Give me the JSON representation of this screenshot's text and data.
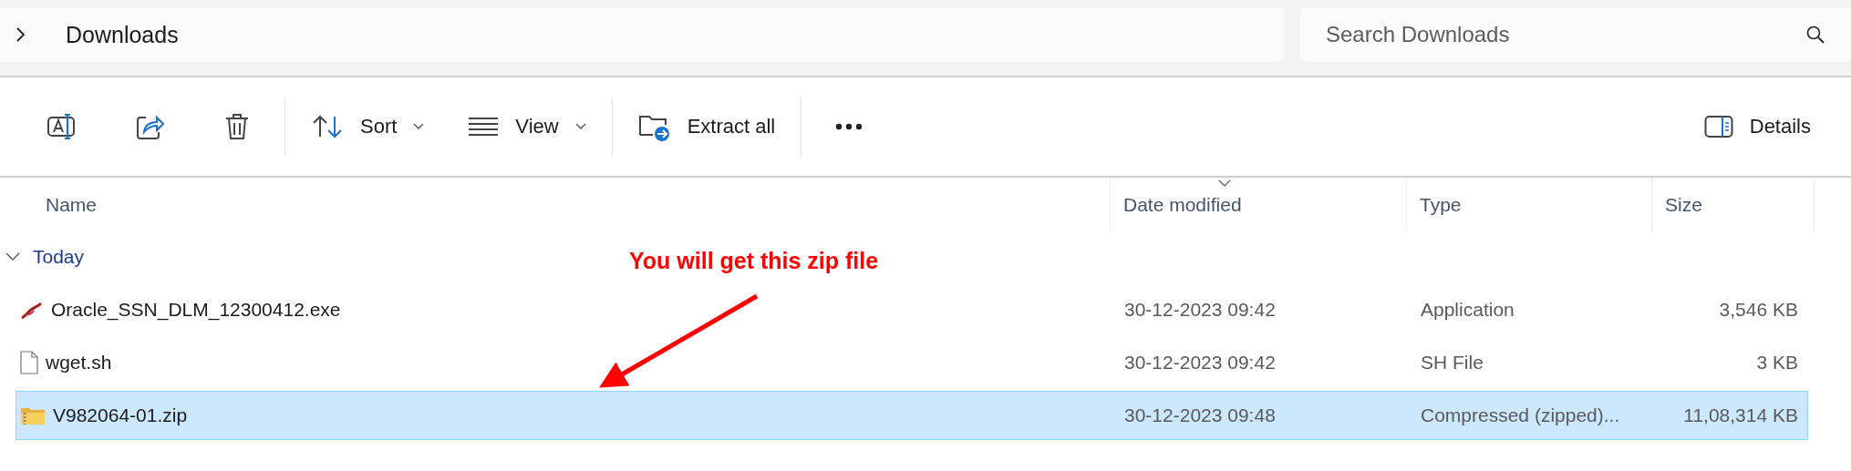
{
  "address": {
    "path": "Downloads"
  },
  "search": {
    "placeholder": "Search Downloads"
  },
  "toolbar": {
    "sort": "Sort",
    "view": "View",
    "extract": "Extract all",
    "details": "Details"
  },
  "columns": [
    {
      "label": "Name",
      "sorted": false
    },
    {
      "label": "Date modified",
      "sorted": true
    },
    {
      "label": "Type",
      "sorted": false
    },
    {
      "label": "Size",
      "sorted": false
    }
  ],
  "group": {
    "label": "Today",
    "expanded": true
  },
  "files": [
    {
      "kind": "exe",
      "name": "Oracle_SSN_DLM_12300412.exe",
      "date": "30-12-2023 09:42",
      "type": "Application",
      "size": "3,546 KB",
      "selected": false
    },
    {
      "kind": "sh",
      "name": "wget.sh",
      "date": "30-12-2023 09:42",
      "type": "SH File",
      "size": "3 KB",
      "selected": false
    },
    {
      "kind": "zip",
      "name": "V982064-01.zip",
      "date": "30-12-2023 09:48",
      "type": "Compressed (zipped)...",
      "size": "11,08,314 KB",
      "selected": true
    }
  ],
  "annotation": {
    "text": "You will get this zip file"
  }
}
